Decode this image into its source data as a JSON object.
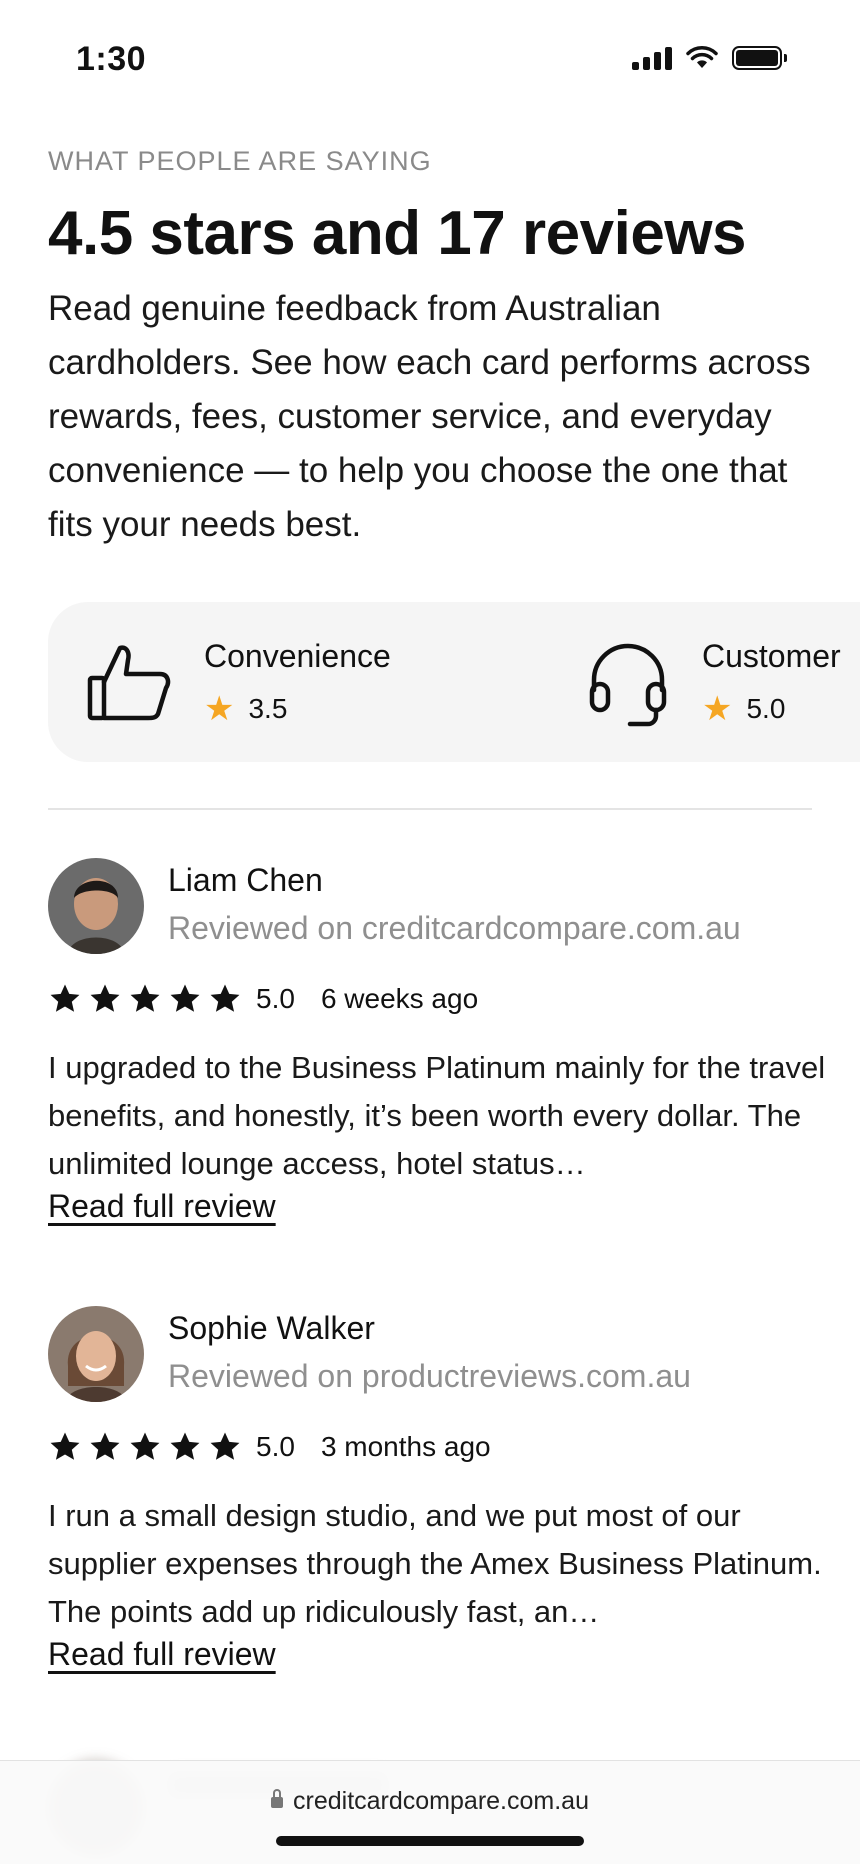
{
  "status_bar": {
    "time": "1:30"
  },
  "header": {
    "eyebrow": "WHAT PEOPLE ARE SAYING",
    "title": "4.5 stars and 17 reviews",
    "description": "Read genuine feedback from Australian cardholders. See how each card performs across rewards, fees, customer service, and everyday convenience — to help you choose the one that fits your needs best."
  },
  "categories": [
    {
      "name": "Convenience",
      "rating": "3.5",
      "icon": "thumbs-up-icon"
    },
    {
      "name": "Customer",
      "rating": "5.0",
      "icon": "headset-icon"
    }
  ],
  "reviews": [
    {
      "name": "Liam Chen",
      "source": "Reviewed on creditcardcompare.com.au",
      "rating": "5.0",
      "stars": 5,
      "age": "6 weeks ago",
      "body": "I upgraded to the Business Platinum mainly for the travel benefits, and honestly, it’s been worth every dollar. The unlimited lounge access, hotel status…",
      "link": "Read full review"
    },
    {
      "name": "Sophie Walker",
      "source": "Reviewed on productreviews.com.au",
      "rating": "5.0",
      "stars": 5,
      "age": "3 months ago",
      "body": "I run a small design studio, and we put most of our supplier expenses through the Amex Business Platinum. The points add up ridiculously fast, an…",
      "link": "Read full review"
    }
  ],
  "browser": {
    "url": "creditcardcompare.com.au"
  },
  "colors": {
    "star_accent": "#f5a623",
    "muted_text": "#8f8f8f",
    "strip_background": "#f5f5f5"
  }
}
